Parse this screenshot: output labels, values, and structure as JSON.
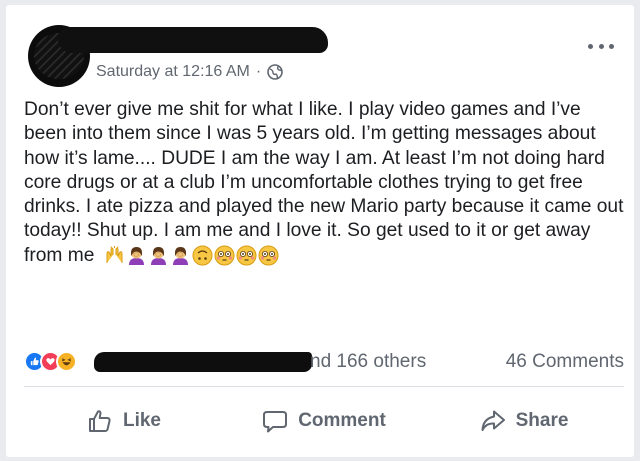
{
  "post": {
    "author_name": "",
    "timestamp": "Saturday at 12:16 AM",
    "separator": "·",
    "privacy_icon": "globe-icon",
    "more_icon": "more-options-icon",
    "text": "Don’t ever give me shit for what I like. I play video games and I’ve been into them since I was 5 years old. I’m getting messages about how it’s lame.... DUDE I am the way I am. At least I’m not doing hard core drugs or at a club I’m uncomfortable clothes trying to get free drinks. I ate pizza and played the new Mario party because it came out today!! Shut up. I am me and I love it. So get used to it or get away from me",
    "emojis": [
      "🙌",
      "🤦‍♀️",
      "🤦‍♀️",
      "🤦‍♀️",
      "🙃",
      "😳",
      "😳",
      "😳"
    ]
  },
  "reactions": {
    "icons": [
      "like-reaction-icon",
      "love-reaction-icon",
      "haha-reaction-icon"
    ],
    "count_text": "nd 166 others",
    "comments_text": "46 Comments"
  },
  "actions": {
    "like_label": "Like",
    "comment_label": "Comment",
    "share_label": "Share"
  },
  "colors": {
    "background": "#e9ebee",
    "card": "#ffffff",
    "secondary_text": "#606770",
    "like_blue": "#1877f2",
    "love_red": "#f33e58",
    "haha_yellow": "#f7b125"
  }
}
